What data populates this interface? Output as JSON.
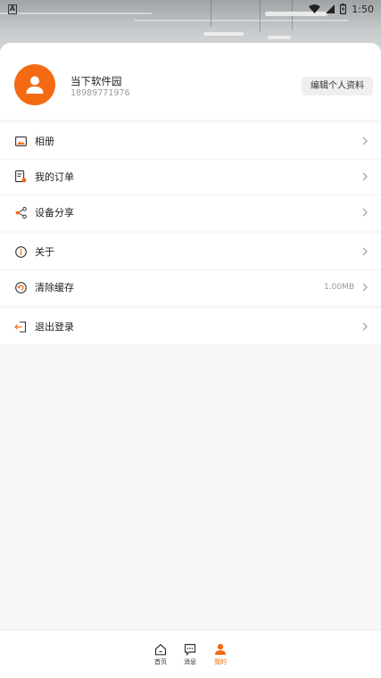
{
  "status": {
    "time": "1:50",
    "left_icon_letter": "A",
    "icons": [
      "wifi-icon",
      "signal-icon",
      "battery-icon"
    ]
  },
  "profile": {
    "name": "当下软件园",
    "phone": "18989771976",
    "edit_label": "编辑个人资料"
  },
  "menu": {
    "group1": [
      {
        "label": "相册",
        "icon": "album-icon"
      },
      {
        "label": "我的订单",
        "icon": "order-icon"
      },
      {
        "label": "设备分享",
        "icon": "share-icon"
      }
    ],
    "group2": [
      {
        "label": "关于",
        "icon": "info-icon"
      },
      {
        "label": "清除缓存",
        "icon": "clear-cache-icon",
        "value": "1.00MB"
      }
    ],
    "group3": [
      {
        "label": "退出登录",
        "icon": "logout-icon"
      }
    ]
  },
  "tabs": [
    {
      "label": "首页",
      "icon": "home-icon",
      "active": false
    },
    {
      "label": "消息",
      "icon": "message-icon",
      "active": false
    },
    {
      "label": "我的",
      "icon": "profile-icon",
      "active": true
    }
  ],
  "colors": {
    "accent": "#f36a13",
    "background": "#f7f7f7",
    "card": "#ffffff"
  }
}
